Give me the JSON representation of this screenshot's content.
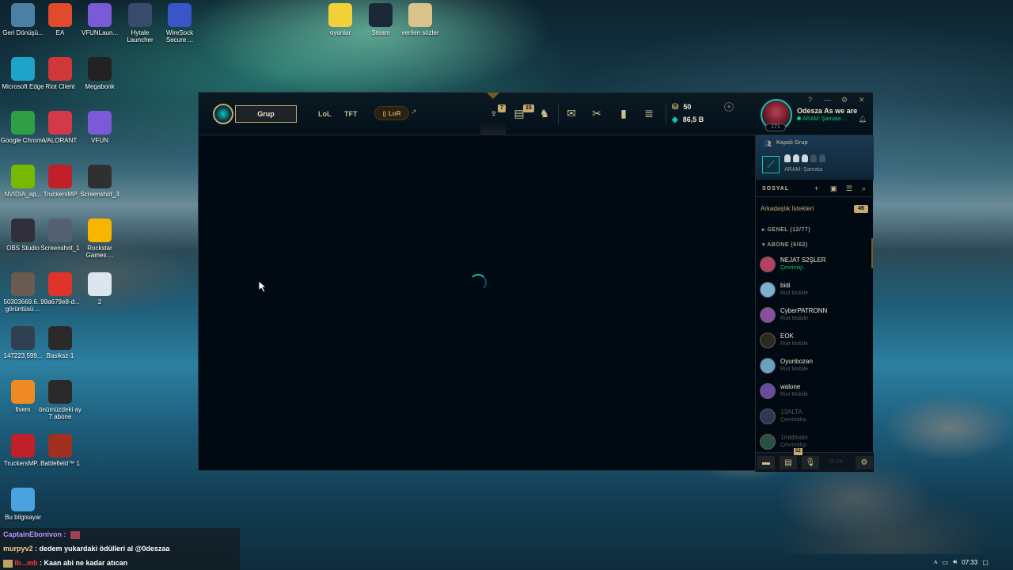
{
  "desktop": {
    "icons": [
      {
        "label": "Geri Dönüşü...",
        "icon": "recycle-bin-icon",
        "color": "#4a7fa6"
      },
      {
        "label": "EA",
        "icon": "ea-icon",
        "color": "#e14a2a"
      },
      {
        "label": "VFUNLaun...",
        "icon": "vfun-icon",
        "color": "#7a5ad6"
      },
      {
        "label": "Hytale Launcher",
        "icon": "hytale-icon",
        "color": "#3a4a6a"
      },
      {
        "label": "WireSock Secure ...",
        "icon": "wiresock-icon",
        "color": "#3a55c8"
      },
      {
        "label": "oyunlar",
        "icon": "star-folder-icon",
        "color": "#f2d03a"
      },
      {
        "label": "Steam",
        "icon": "steam-icon",
        "color": "#1b2838"
      },
      {
        "label": "verilen sözler",
        "icon": "document-icon",
        "color": "#d9c38a"
      },
      {
        "label": "Microsoft Edge",
        "icon": "edge-icon",
        "color": "#1fa3c9"
      },
      {
        "label": "Riot Client",
        "icon": "riot-icon",
        "color": "#d13639"
      },
      {
        "label": "Megabonk",
        "icon": "megabonk-icon",
        "color": "#222222"
      },
      {
        "label": "Google Chrome",
        "icon": "chrome-icon",
        "color": "#2f9e44"
      },
      {
        "label": "VALORANT",
        "icon": "valorant-icon",
        "color": "#d23a4a"
      },
      {
        "label": "VFUN",
        "icon": "vfun-icon",
        "color": "#7a5ad6"
      },
      {
        "label": "NVIDIA_ap...",
        "icon": "nvidia-icon",
        "color": "#76b900"
      },
      {
        "label": "TruckersMP",
        "icon": "truckersmp-icon",
        "color": "#c0202a"
      },
      {
        "label": "Screenshot_3",
        "icon": "screenshot-icon",
        "color": "#303030"
      },
      {
        "label": "OBS Studio",
        "icon": "obs-icon",
        "color": "#302f3a"
      },
      {
        "label": "Screenshot_1",
        "icon": "screenshot-icon",
        "color": "#556070"
      },
      {
        "label": "Rockstar Games ...",
        "icon": "rockstar-icon",
        "color": "#f7b500"
      },
      {
        "label": "50303669.6... görüntüsü ...",
        "icon": "image-icon",
        "color": "#6a5a50"
      },
      {
        "label": "99a679e8-d...",
        "icon": "pdf-icon",
        "color": "#e0332a"
      },
      {
        "label": "2",
        "icon": "text-file-icon",
        "color": "#dde6f0"
      },
      {
        "label": "147223.599...",
        "icon": "image-icon",
        "color": "#304050"
      },
      {
        "label": "Basiksz-1",
        "icon": "basic-icon",
        "color": "#2a2a2a"
      },
      {
        "label": "fivem",
        "icon": "fivem-icon",
        "color": "#f08a24"
      },
      {
        "label": "önümüzdeki ay 7 abone",
        "icon": "note-icon",
        "color": "#2a2a2a"
      },
      {
        "label": "TruckersMP...",
        "icon": "truckersmp-icon",
        "color": "#c0202a"
      },
      {
        "label": "Battlefield™ 1",
        "icon": "battlefield-icon",
        "color": "#a03020"
      },
      {
        "label": "Bu bilgisayar",
        "icon": "computer-icon",
        "color": "#4aa3e0"
      }
    ]
  },
  "client": {
    "nav": {
      "play_label": "Grup",
      "lol": "LoL",
      "tft": "TFT",
      "lor": "LoR",
      "lor_arrow": "↗"
    },
    "toolbar": {
      "badge_1": "7",
      "badge_2": "15"
    },
    "currency": {
      "blue_essence": "50",
      "riot_points": "86,5 B"
    },
    "summoner": {
      "level": "171",
      "name": "Odesza As we are",
      "status": "ARAM: Şamata ..."
    },
    "party": {
      "title": "Kapalı Grup",
      "mode": "ARAM: Şamata"
    },
    "social": {
      "title": "SOSYAL",
      "requests_label": "Arkadaşlık İstekleri",
      "requests_count": "49",
      "group_general": "GENEL (12/77)",
      "group_subs": "ABONE (6/62)",
      "friends": [
        {
          "name": "NEJAT S2ŞLER",
          "status": "Çevrimiçi",
          "state": "online",
          "color": "#b84060"
        },
        {
          "name": "bidi",
          "status": "Riot Mobile",
          "state": "mobile",
          "color": "#7ab0d0"
        },
        {
          "name": "CyberPATRONN",
          "status": "Riot Mobile",
          "state": "mobile",
          "color": "#8a50a0"
        },
        {
          "name": "EOK",
          "status": "Riot Mobile",
          "state": "mobile",
          "color": "#2a2a20"
        },
        {
          "name": "Oyunbozan",
          "status": "Riot Mobile",
          "state": "mobile",
          "color": "#6aa0c0"
        },
        {
          "name": "walone",
          "status": "Riot Mobile",
          "state": "mobile",
          "color": "#6a4aa0"
        },
        {
          "name": "13ALTA",
          "status": "Çevrimdışı",
          "state": "offline",
          "color": "#2a3a50"
        },
        {
          "name": "1midmain",
          "status": "Çevrimdışı",
          "state": "offline",
          "color": "#2a5040"
        }
      ],
      "footer_badge": "52",
      "footer_version": "26.04"
    }
  },
  "chat": {
    "lines": [
      {
        "user": "CaptainEbonivon :",
        "text": ""
      },
      {
        "user": "murpyv2 :",
        "text": "dedem yukardaki ödülleri al @0deszaa"
      },
      {
        "user": "lb...mb",
        "text": ": Kaan abi ne kadar atıcan"
      }
    ]
  },
  "tray": {
    "time": "07:33"
  }
}
